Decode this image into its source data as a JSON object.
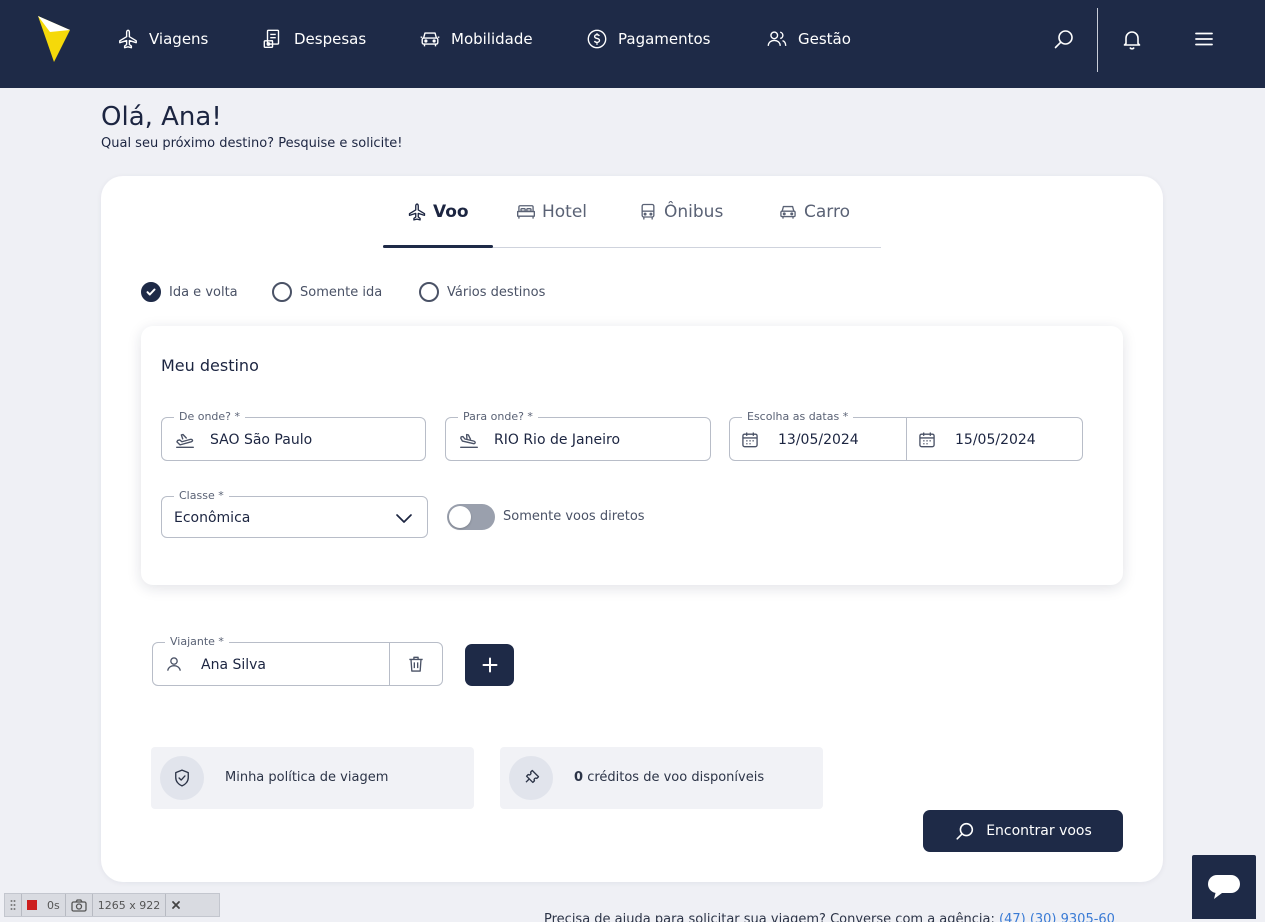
{
  "nav": {
    "items": [
      {
        "label": "Viagens",
        "icon": "plane-icon"
      },
      {
        "label": "Despesas",
        "icon": "receipt-icon"
      },
      {
        "label": "Mobilidade",
        "icon": "car-icon"
      },
      {
        "label": "Pagamentos",
        "icon": "dollar-icon"
      },
      {
        "label": "Gestão",
        "icon": "users-icon"
      }
    ]
  },
  "greeting": {
    "title": "Olá, Ana!",
    "subtitle": "Qual seu próximo destino? Pesquise e solicite!"
  },
  "tabs": [
    {
      "label": "Voo",
      "active": true
    },
    {
      "label": "Hotel",
      "active": false
    },
    {
      "label": "Ônibus",
      "active": false
    },
    {
      "label": "Carro",
      "active": false
    }
  ],
  "trip_type": {
    "options": [
      "Ida e volta",
      "Somente ida",
      "Vários destinos"
    ],
    "selected": "Ida e volta"
  },
  "destination": {
    "title": "Meu destino",
    "origin": {
      "label": "De onde? *",
      "value": "SAO São Paulo"
    },
    "destination": {
      "label": "Para onde? *",
      "value": "RIO Rio de Janeiro"
    },
    "dates": {
      "label": "Escolha as datas *",
      "start": "13/05/2024",
      "end": "15/05/2024"
    },
    "class": {
      "label": "Classe *",
      "value": "Econômica"
    },
    "direct_only": {
      "label": "Somente voos diretos",
      "on": false
    }
  },
  "traveler": {
    "label": "Viajante *",
    "value": "Ana Silva"
  },
  "policy": {
    "label": "Minha política de viagem"
  },
  "credits": {
    "count": "0",
    "label": "créditos de voo disponíveis"
  },
  "search_button": {
    "label": "Encontrar voos"
  },
  "footer": {
    "help_text": "Precisa de ajuda para solicitar sua viagem? Converse com a agência:",
    "phone": "(47) (30) 9305-60"
  },
  "recorder": {
    "time": "0s",
    "size": "1265 x 922"
  },
  "colors": {
    "navy": "#1e2a47",
    "background": "#eff0f5",
    "logo": "#f5d90a"
  }
}
